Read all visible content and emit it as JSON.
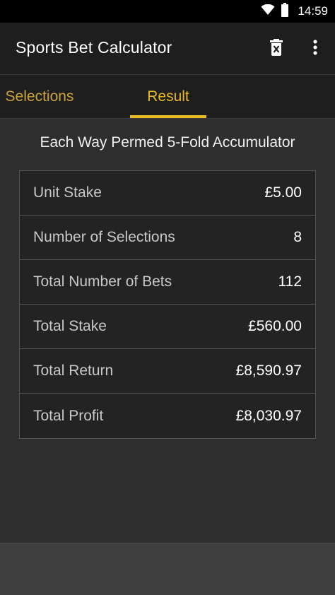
{
  "status_bar": {
    "time": "14:59",
    "icons": [
      "wifi-icon",
      "battery-icon"
    ]
  },
  "app_bar": {
    "title": "Sports Bet Calculator",
    "actions": [
      "delete-icon",
      "more-vert-icon"
    ]
  },
  "tabs": [
    {
      "label": "Selections",
      "selected": false
    },
    {
      "label": "Result",
      "selected": true
    }
  ],
  "result": {
    "bet_type": "Each Way Permed 5-Fold Accumulator",
    "rows": [
      {
        "label": "Unit Stake",
        "value": "£5.00"
      },
      {
        "label": "Number of Selections",
        "value": "8"
      },
      {
        "label": "Total Number of Bets",
        "value": "112"
      },
      {
        "label": "Total Stake",
        "value": "£560.00"
      },
      {
        "label": "Total Return",
        "value": "£8,590.97"
      },
      {
        "label": "Total Profit",
        "value": "£8,030.97"
      }
    ]
  },
  "colors": {
    "accent": "#e8b923",
    "toolbar": "#1e1e1e",
    "background": "#2e2e2e",
    "table": "#232323"
  }
}
